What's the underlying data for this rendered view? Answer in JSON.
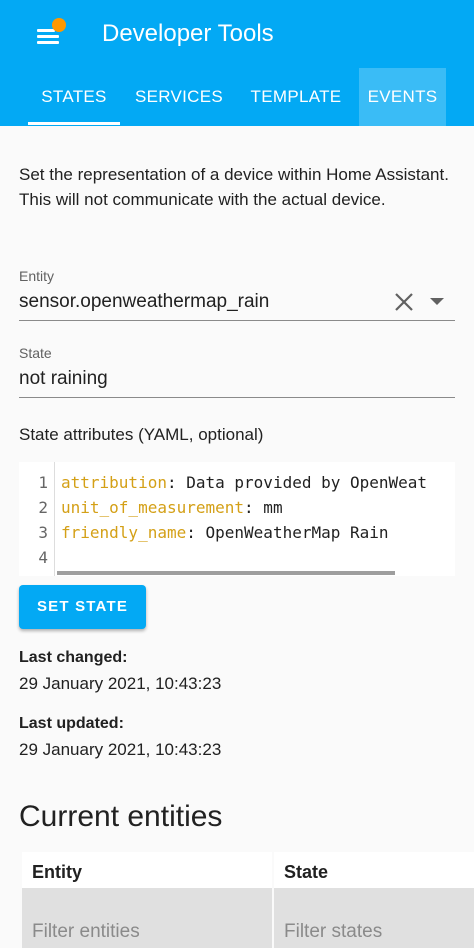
{
  "header": {
    "title": "Developer Tools",
    "tabs": [
      {
        "label": "STATES"
      },
      {
        "label": "SERVICES"
      },
      {
        "label": "TEMPLATE"
      },
      {
        "label": "EVENTS"
      }
    ],
    "active_tab": "STATES",
    "colors": {
      "primary": "#03a9f4",
      "badge": "#ff9800"
    }
  },
  "description": {
    "line1": "Set the representation of a device within Home Assistant.",
    "line2": "This will not communicate with the actual device."
  },
  "entity": {
    "label": "Entity",
    "value": "sensor.openweathermap_rain",
    "clear_icon": "close-icon",
    "dropdown_icon": "arrow-drop-down-icon"
  },
  "state": {
    "label": "State",
    "value": "not raining"
  },
  "attributes": {
    "label": "State attributes (YAML, optional)",
    "lines": [
      {
        "num": "1",
        "key": "attribution",
        "value": " Data provided by OpenWeat"
      },
      {
        "num": "2",
        "key": "unit_of_measurement",
        "value": " mm"
      },
      {
        "num": "3",
        "key": "friendly_name",
        "value": " OpenWeatherMap Rain"
      },
      {
        "num": "4",
        "key": "",
        "value": ""
      }
    ]
  },
  "set_state_label": "SET STATE",
  "last_changed": {
    "label": "Last changed:",
    "value": "29 January 2021, 10:43:23"
  },
  "last_updated": {
    "label": "Last updated:",
    "value": "29 January 2021, 10:43:23"
  },
  "current_entities": {
    "title": "Current entities",
    "columns": [
      "Entity",
      "State"
    ],
    "filter_entities_placeholder": "Filter entities",
    "filter_states_placeholder": "Filter states"
  }
}
